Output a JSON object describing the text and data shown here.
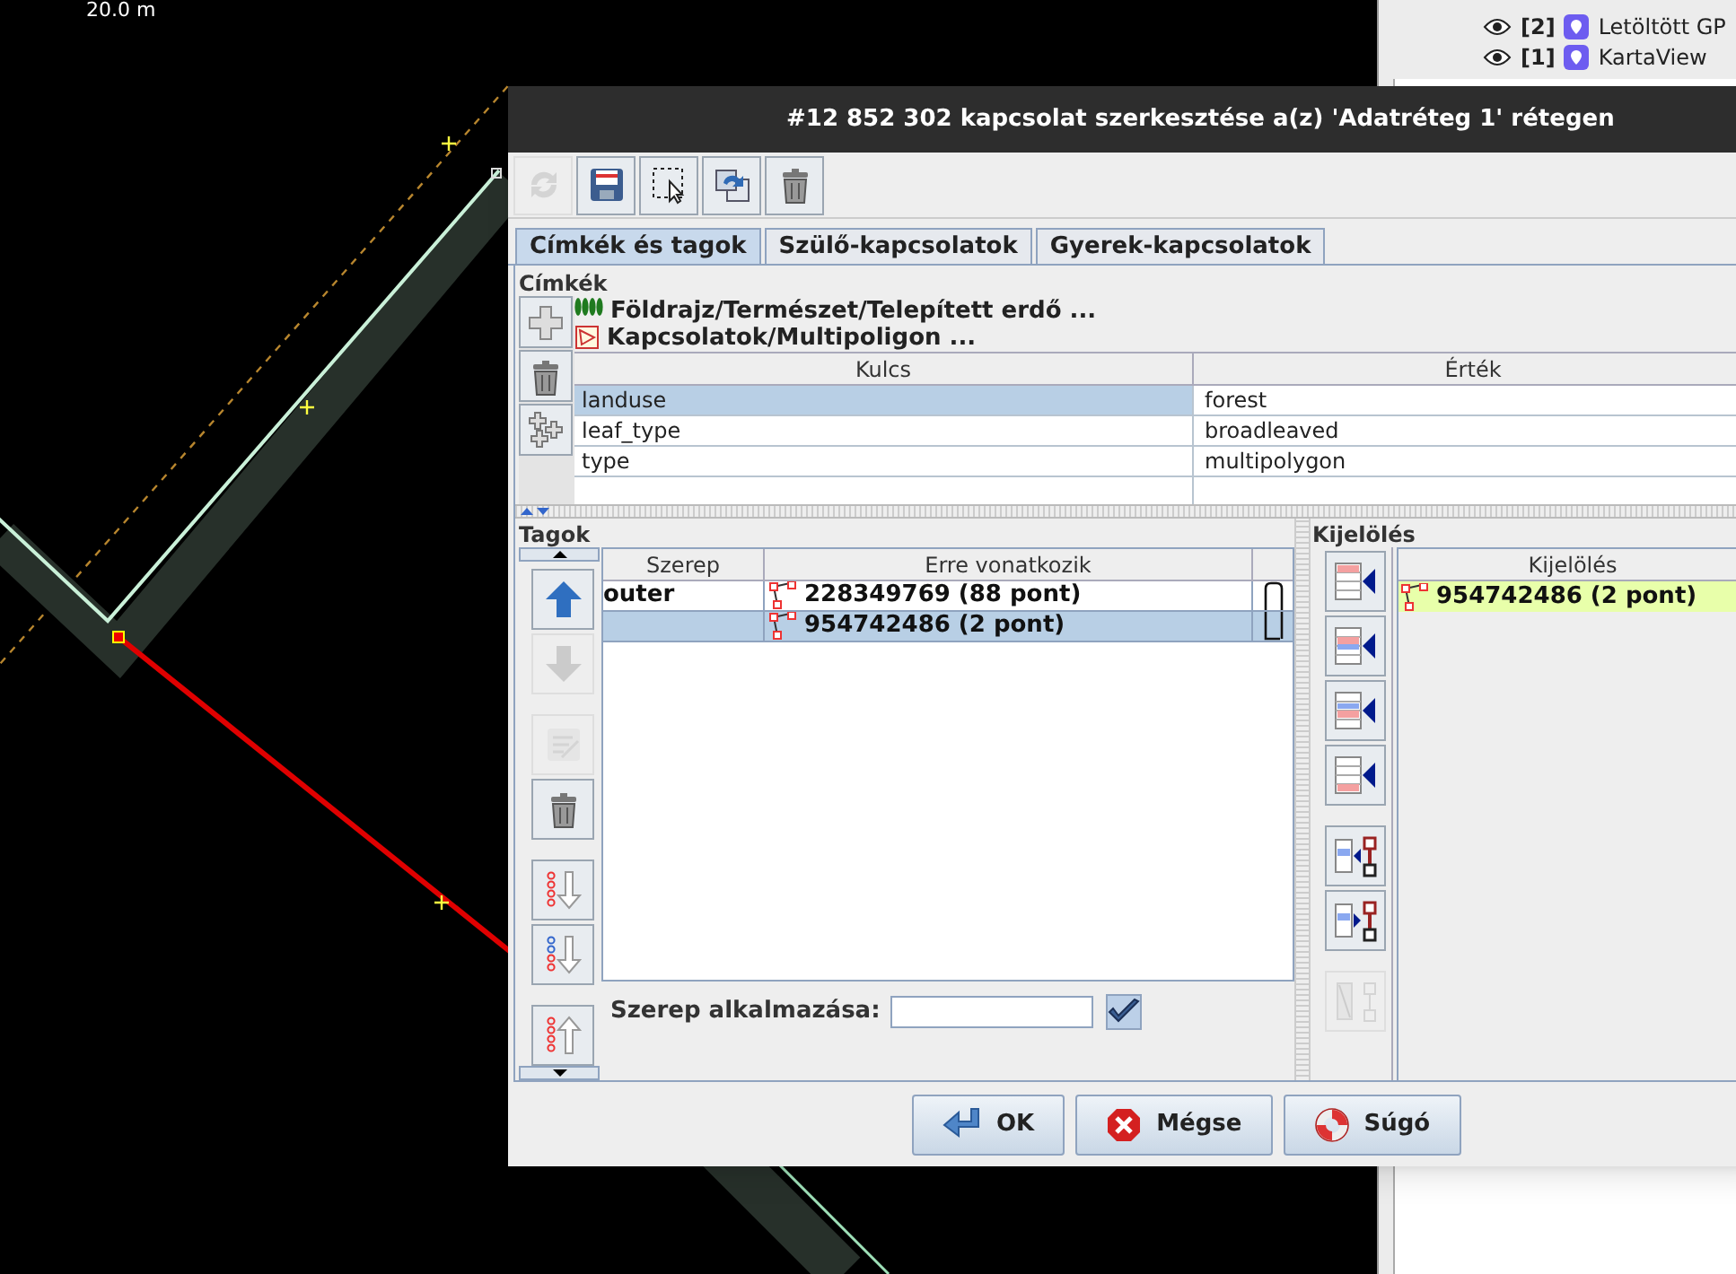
{
  "map": {
    "scale": "20.0 m"
  },
  "layers": [
    {
      "index": "[2]",
      "name": "Letöltött GP",
      "visible": true
    },
    {
      "index": "[1]",
      "name": "KartaView",
      "visible": true
    }
  ],
  "dialog": {
    "title": "#12 852 302 kapcsolat szerkesztése a(z) 'Adatréteg 1' rétegen",
    "toolbar": [
      {
        "kind": "refresh",
        "disabled": true
      },
      {
        "kind": "save",
        "disabled": false
      },
      {
        "kind": "select",
        "disabled": false
      },
      {
        "kind": "duplicate",
        "disabled": false
      },
      {
        "kind": "delete",
        "disabled": false
      }
    ],
    "tabs": [
      {
        "label": "Címkék és tagok",
        "selected": true
      },
      {
        "label": "Szülő-kapcsolatok",
        "selected": false
      },
      {
        "label": "Gyerek-kapcsolatok",
        "selected": false
      }
    ],
    "tags": {
      "heading": "Címkék",
      "buttons": [
        {
          "kind": "add",
          "disabled": false
        },
        {
          "kind": "delete",
          "disabled": false
        },
        {
          "kind": "paste",
          "disabled": false
        }
      ],
      "presets": [
        {
          "kind": "forest",
          "label": "Földrajz/Természet/Telepített erdő ..."
        },
        {
          "kind": "multipolygon",
          "label": "Kapcsolatok/Multipoligon ..."
        }
      ],
      "columns": [
        "Kulcs",
        "Érték"
      ],
      "rows": [
        {
          "key": "landuse",
          "value": "forest",
          "selected": true
        },
        {
          "key": "leaf_type",
          "value": "broadleaved",
          "selected": false
        },
        {
          "key": "type",
          "value": "multipolygon",
          "selected": false
        }
      ]
    },
    "members": {
      "heading": "Tagok",
      "columns": [
        "Szerep",
        "Erre vonatkozik"
      ],
      "rows": [
        {
          "role": "outer",
          "member": "228349769 (88 pont)",
          "selected": false
        },
        {
          "member": "954742486 (2 pont)",
          "selected": true
        }
      ],
      "buttons": [
        {
          "kind": "up",
          "disabled": false
        },
        {
          "kind": "down",
          "disabled": true
        },
        {
          "kind": "edit",
          "disabled": true
        },
        {
          "kind": "delete",
          "disabled": false
        },
        {
          "kind": "sort",
          "disabled": false
        },
        {
          "kind": "reverse",
          "disabled": false
        },
        {
          "kind": "sort-up",
          "disabled": false
        }
      ],
      "role_label": "Szerep alkalmazása:"
    },
    "selection": {
      "heading": "Kijelölés",
      "column": "Kijelölés",
      "rows": [
        {
          "member": "954742486 (2 pont)"
        }
      ],
      "buttons": [
        {
          "kind": "add-top",
          "disabled": false
        },
        {
          "kind": "add-before",
          "disabled": false
        },
        {
          "kind": "add-after",
          "disabled": false
        },
        {
          "kind": "add-bottom",
          "disabled": false
        },
        {
          "kind": "select-member",
          "disabled": false
        },
        {
          "kind": "add-member",
          "disabled": false
        },
        {
          "kind": "remove",
          "disabled": true
        }
      ]
    },
    "buttons": [
      {
        "kind": "ok",
        "label": "OK"
      },
      {
        "kind": "cancel",
        "label": "Mégse"
      },
      {
        "kind": "help",
        "label": "Súgó"
      }
    ]
  }
}
